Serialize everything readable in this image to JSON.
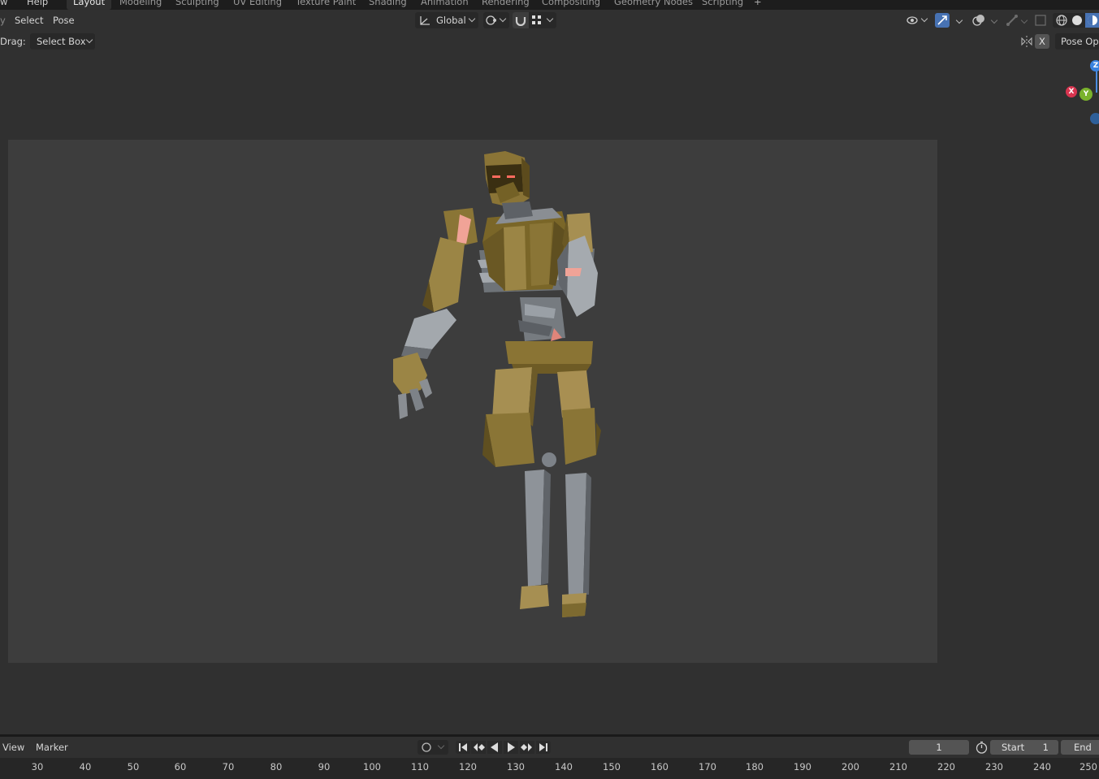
{
  "topbar": {
    "menus": [
      "w",
      "Help"
    ],
    "tabs": [
      "Layout",
      "Modeling",
      "Sculpting",
      "UV Editing",
      "Texture Paint",
      "Shading",
      "Animation",
      "Rendering",
      "Compositing",
      "Geometry Nodes",
      "Scripting"
    ],
    "add_tab": "+"
  },
  "header": {
    "menus": [
      "Select",
      "Pose"
    ],
    "orientation": "Global"
  },
  "toolsettings": {
    "drag_label": "Drag:",
    "drag_value": "Select Box",
    "x_label": "X",
    "pose_options": "Pose Opt"
  },
  "gizmo": {
    "z": "Z",
    "x": "X",
    "y": "Y"
  },
  "timeline": {
    "menus": [
      "View",
      "Marker"
    ],
    "current_frame": "1",
    "start_label": "Start",
    "start_value": "1",
    "end_label": "End",
    "ticks": [
      "30",
      "40",
      "50",
      "60",
      "70",
      "80",
      "90",
      "100",
      "110",
      "120",
      "130",
      "140",
      "150",
      "160",
      "170",
      "180",
      "190",
      "200",
      "210",
      "220",
      "230",
      "240",
      "250"
    ]
  },
  "colors": {
    "accent": "#4772b3",
    "gold": "#8d7a3b",
    "steel": "#8e9399"
  }
}
